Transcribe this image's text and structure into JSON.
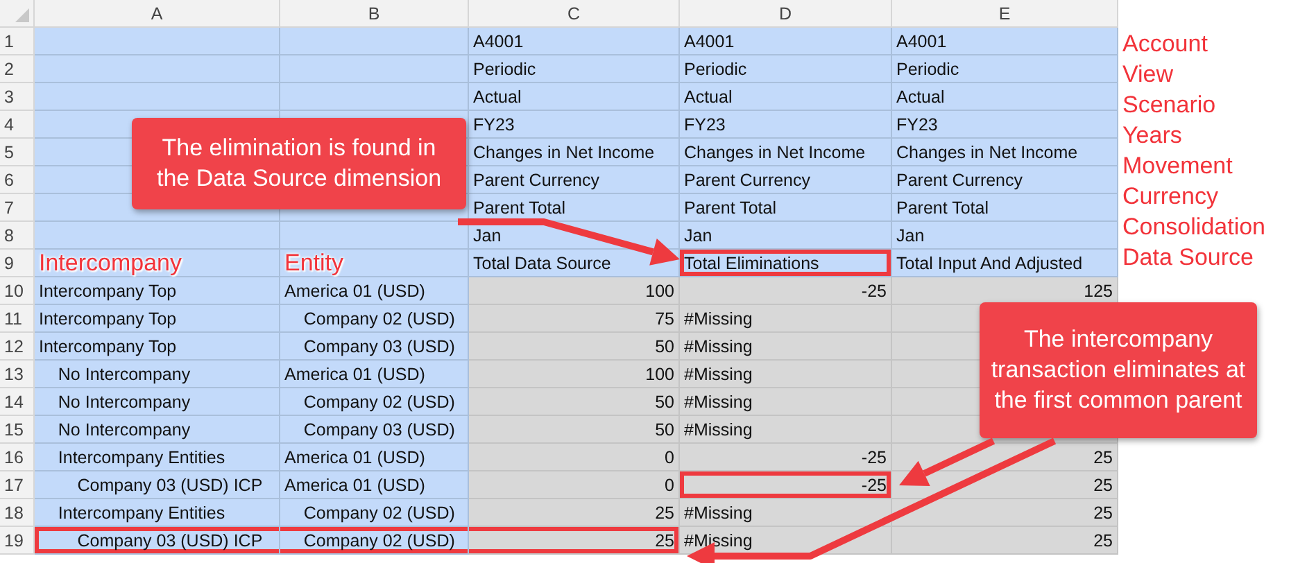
{
  "column_headers": [
    "A",
    "B",
    "C",
    "D",
    "E"
  ],
  "rows": [
    {
      "number": "1",
      "kind": "dimension",
      "cells": [
        null,
        null,
        {
          "text": "A4001",
          "kind": "text",
          "outlined": false
        },
        {
          "text": "A4001",
          "kind": "text",
          "outlined": false
        },
        {
          "text": "A4001",
          "kind": "text",
          "outlined": false
        }
      ]
    },
    {
      "number": "2",
      "kind": "dimension",
      "cells": [
        null,
        null,
        {
          "text": "Periodic",
          "kind": "text",
          "outlined": false
        },
        {
          "text": "Periodic",
          "kind": "text",
          "outlined": false
        },
        {
          "text": "Periodic",
          "kind": "text",
          "outlined": false
        }
      ]
    },
    {
      "number": "3",
      "kind": "dimension",
      "cells": [
        null,
        null,
        {
          "text": "Actual",
          "kind": "text",
          "outlined": false
        },
        {
          "text": "Actual",
          "kind": "text",
          "outlined": false
        },
        {
          "text": "Actual",
          "kind": "text",
          "outlined": false
        }
      ]
    },
    {
      "number": "4",
      "kind": "dimension",
      "cells": [
        null,
        null,
        {
          "text": "FY23",
          "kind": "text",
          "outlined": false
        },
        {
          "text": "FY23",
          "kind": "text",
          "outlined": false
        },
        {
          "text": "FY23",
          "kind": "text",
          "outlined": false
        }
      ]
    },
    {
      "number": "5",
      "kind": "dimension",
      "cells": [
        null,
        null,
        {
          "text": "Changes in Net Income",
          "kind": "text",
          "outlined": false
        },
        {
          "text": "Changes in Net Income",
          "kind": "text",
          "outlined": false
        },
        {
          "text": "Changes in Net Income",
          "kind": "text",
          "outlined": false
        }
      ]
    },
    {
      "number": "6",
      "kind": "dimension",
      "cells": [
        null,
        null,
        {
          "text": "Parent Currency",
          "kind": "text",
          "outlined": false
        },
        {
          "text": "Parent Currency",
          "kind": "text",
          "outlined": false
        },
        {
          "text": "Parent Currency",
          "kind": "text",
          "outlined": false
        }
      ]
    },
    {
      "number": "7",
      "kind": "dimension",
      "cells": [
        null,
        null,
        {
          "text": "Parent Total",
          "kind": "text",
          "outlined": false
        },
        {
          "text": "Parent Total",
          "kind": "text",
          "outlined": false
        },
        {
          "text": "Parent Total",
          "kind": "text",
          "outlined": false
        }
      ]
    },
    {
      "number": "8",
      "kind": "dimension",
      "cells": [
        null,
        null,
        {
          "text": "Jan",
          "kind": "text",
          "outlined": false
        },
        {
          "text": "Jan",
          "kind": "text",
          "outlined": false
        },
        {
          "text": "Jan",
          "kind": "text",
          "outlined": false
        }
      ]
    },
    {
      "number": "9",
      "kind": "dimension",
      "cells": [
        {
          "text": "Intercompany",
          "kind": "label",
          "outlined": false
        },
        {
          "text": "Entity",
          "kind": "label",
          "outlined": false
        },
        {
          "text": "Total Data Source",
          "kind": "text",
          "outlined": false
        },
        {
          "text": "Total Eliminations",
          "kind": "text",
          "outlined": true
        },
        {
          "text": "Total Input And Adjusted",
          "kind": "text",
          "outlined": false
        }
      ]
    },
    {
      "number": "10",
      "kind": "data",
      "cells": [
        {
          "text": "Intercompany Top",
          "kind": "text",
          "outlined": false
        },
        {
          "text": "America 01 (USD)",
          "kind": "text",
          "outlined": false
        },
        {
          "text": "100",
          "kind": "number",
          "outlined": false
        },
        {
          "text": "-25",
          "kind": "number",
          "outlined": false
        },
        {
          "text": "125",
          "kind": "number",
          "outlined": false
        }
      ]
    },
    {
      "number": "11",
      "kind": "data",
      "cells": [
        {
          "text": "Intercompany Top",
          "kind": "text",
          "outlined": false
        },
        {
          "text": "    Company 02 (USD)",
          "kind": "text",
          "outlined": false
        },
        {
          "text": "75",
          "kind": "number",
          "outlined": false
        },
        {
          "text": "#Missing",
          "kind": "text",
          "outlined": false
        },
        null
      ]
    },
    {
      "number": "12",
      "kind": "data",
      "cells": [
        {
          "text": "Intercompany Top",
          "kind": "text",
          "outlined": false
        },
        {
          "text": "    Company 03 (USD)",
          "kind": "text",
          "outlined": false
        },
        {
          "text": "50",
          "kind": "number",
          "outlined": false
        },
        {
          "text": "#Missing",
          "kind": "text",
          "outlined": false
        },
        null
      ]
    },
    {
      "number": "13",
      "kind": "data",
      "cells": [
        {
          "text": "    No Intercompany",
          "kind": "text",
          "outlined": false
        },
        {
          "text": "America 01 (USD)",
          "kind": "text",
          "outlined": false
        },
        {
          "text": "100",
          "kind": "number",
          "outlined": false
        },
        {
          "text": "#Missing",
          "kind": "text",
          "outlined": false
        },
        null
      ]
    },
    {
      "number": "14",
      "kind": "data",
      "cells": [
        {
          "text": "    No Intercompany",
          "kind": "text",
          "outlined": false
        },
        {
          "text": "    Company 02 (USD)",
          "kind": "text",
          "outlined": false
        },
        {
          "text": "50",
          "kind": "number",
          "outlined": false
        },
        {
          "text": "#Missing",
          "kind": "text",
          "outlined": false
        },
        null
      ]
    },
    {
      "number": "15",
      "kind": "data",
      "cells": [
        {
          "text": "    No Intercompany",
          "kind": "text",
          "outlined": false
        },
        {
          "text": "    Company 03 (USD)",
          "kind": "text",
          "outlined": false
        },
        {
          "text": "50",
          "kind": "number",
          "outlined": false
        },
        {
          "text": "#Missing",
          "kind": "text",
          "outlined": false
        },
        null
      ]
    },
    {
      "number": "16",
      "kind": "data",
      "cells": [
        {
          "text": "    Intercompany Entities",
          "kind": "text",
          "outlined": false
        },
        {
          "text": "America 01 (USD)",
          "kind": "text",
          "outlined": false
        },
        {
          "text": "0",
          "kind": "number",
          "outlined": false
        },
        {
          "text": "-25",
          "kind": "number",
          "outlined": false
        },
        {
          "text": "25",
          "kind": "number",
          "outlined": false
        }
      ]
    },
    {
      "number": "17",
      "kind": "data",
      "cells": [
        {
          "text": "        Company 03 (USD) ICP",
          "kind": "text",
          "outlined": false
        },
        {
          "text": "America 01 (USD)",
          "kind": "text",
          "outlined": false
        },
        {
          "text": "0",
          "kind": "number",
          "outlined": false
        },
        {
          "text": "-25",
          "kind": "number",
          "outlined": true
        },
        {
          "text": "25",
          "kind": "number",
          "outlined": false
        }
      ]
    },
    {
      "number": "18",
      "kind": "data",
      "cells": [
        {
          "text": "    Intercompany Entities",
          "kind": "text",
          "outlined": false
        },
        {
          "text": "    Company 02 (USD)",
          "kind": "text",
          "outlined": false
        },
        {
          "text": "25",
          "kind": "number",
          "outlined": false
        },
        {
          "text": "#Missing",
          "kind": "text",
          "outlined": false
        },
        {
          "text": "25",
          "kind": "number",
          "outlined": false
        }
      ]
    },
    {
      "number": "19",
      "kind": "data",
      "cells": [
        {
          "text": "        Company 03 (USD) ICP",
          "kind": "text",
          "outlined": true
        },
        {
          "text": "    Company 02 (USD)",
          "kind": "text",
          "outlined": true
        },
        {
          "text": "25",
          "kind": "number",
          "outlined": true
        },
        {
          "text": "#Missing",
          "kind": "text",
          "outlined": false
        },
        {
          "text": "25",
          "kind": "number",
          "outlined": false
        }
      ]
    }
  ],
  "dimension_labels": [
    "Account",
    "View",
    "Scenario",
    "Years",
    "Movement",
    "Currency",
    "Consolidation",
    "Data Source"
  ],
  "callouts": [
    {
      "text": "The elimination is found in the Data Source dimension"
    },
    {
      "text": "The intercompany transaction eliminates at the first common parent"
    }
  ]
}
